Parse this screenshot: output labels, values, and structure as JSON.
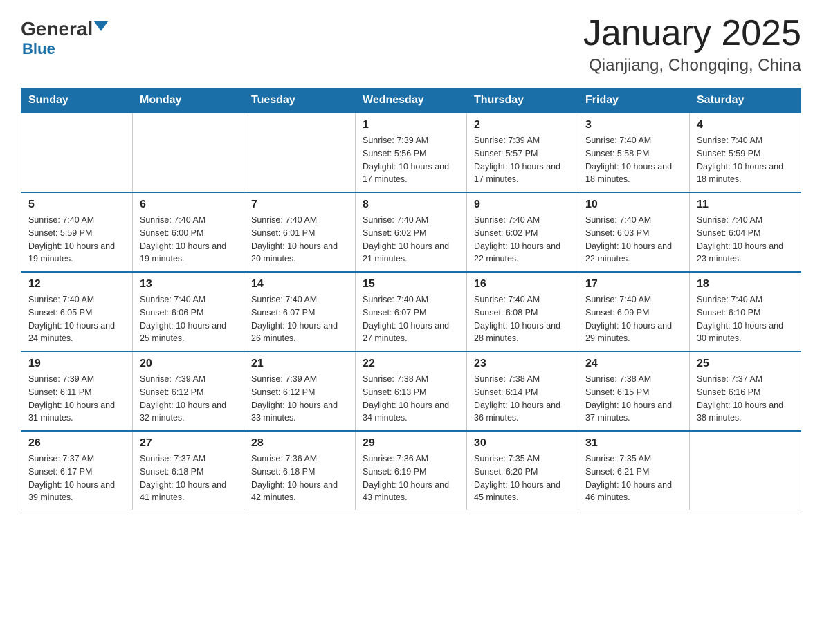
{
  "header": {
    "logo_general": "General",
    "logo_blue": "Blue",
    "title": "January 2025",
    "subtitle": "Qianjiang, Chongqing, China"
  },
  "days_of_week": [
    "Sunday",
    "Monday",
    "Tuesday",
    "Wednesday",
    "Thursday",
    "Friday",
    "Saturday"
  ],
  "weeks": [
    [
      {
        "day": "",
        "info": ""
      },
      {
        "day": "",
        "info": ""
      },
      {
        "day": "",
        "info": ""
      },
      {
        "day": "1",
        "info": "Sunrise: 7:39 AM\nSunset: 5:56 PM\nDaylight: 10 hours\nand 17 minutes."
      },
      {
        "day": "2",
        "info": "Sunrise: 7:39 AM\nSunset: 5:57 PM\nDaylight: 10 hours\nand 17 minutes."
      },
      {
        "day": "3",
        "info": "Sunrise: 7:40 AM\nSunset: 5:58 PM\nDaylight: 10 hours\nand 18 minutes."
      },
      {
        "day": "4",
        "info": "Sunrise: 7:40 AM\nSunset: 5:59 PM\nDaylight: 10 hours\nand 18 minutes."
      }
    ],
    [
      {
        "day": "5",
        "info": "Sunrise: 7:40 AM\nSunset: 5:59 PM\nDaylight: 10 hours\nand 19 minutes."
      },
      {
        "day": "6",
        "info": "Sunrise: 7:40 AM\nSunset: 6:00 PM\nDaylight: 10 hours\nand 19 minutes."
      },
      {
        "day": "7",
        "info": "Sunrise: 7:40 AM\nSunset: 6:01 PM\nDaylight: 10 hours\nand 20 minutes."
      },
      {
        "day": "8",
        "info": "Sunrise: 7:40 AM\nSunset: 6:02 PM\nDaylight: 10 hours\nand 21 minutes."
      },
      {
        "day": "9",
        "info": "Sunrise: 7:40 AM\nSunset: 6:02 PM\nDaylight: 10 hours\nand 22 minutes."
      },
      {
        "day": "10",
        "info": "Sunrise: 7:40 AM\nSunset: 6:03 PM\nDaylight: 10 hours\nand 22 minutes."
      },
      {
        "day": "11",
        "info": "Sunrise: 7:40 AM\nSunset: 6:04 PM\nDaylight: 10 hours\nand 23 minutes."
      }
    ],
    [
      {
        "day": "12",
        "info": "Sunrise: 7:40 AM\nSunset: 6:05 PM\nDaylight: 10 hours\nand 24 minutes."
      },
      {
        "day": "13",
        "info": "Sunrise: 7:40 AM\nSunset: 6:06 PM\nDaylight: 10 hours\nand 25 minutes."
      },
      {
        "day": "14",
        "info": "Sunrise: 7:40 AM\nSunset: 6:07 PM\nDaylight: 10 hours\nand 26 minutes."
      },
      {
        "day": "15",
        "info": "Sunrise: 7:40 AM\nSunset: 6:07 PM\nDaylight: 10 hours\nand 27 minutes."
      },
      {
        "day": "16",
        "info": "Sunrise: 7:40 AM\nSunset: 6:08 PM\nDaylight: 10 hours\nand 28 minutes."
      },
      {
        "day": "17",
        "info": "Sunrise: 7:40 AM\nSunset: 6:09 PM\nDaylight: 10 hours\nand 29 minutes."
      },
      {
        "day": "18",
        "info": "Sunrise: 7:40 AM\nSunset: 6:10 PM\nDaylight: 10 hours\nand 30 minutes."
      }
    ],
    [
      {
        "day": "19",
        "info": "Sunrise: 7:39 AM\nSunset: 6:11 PM\nDaylight: 10 hours\nand 31 minutes."
      },
      {
        "day": "20",
        "info": "Sunrise: 7:39 AM\nSunset: 6:12 PM\nDaylight: 10 hours\nand 32 minutes."
      },
      {
        "day": "21",
        "info": "Sunrise: 7:39 AM\nSunset: 6:12 PM\nDaylight: 10 hours\nand 33 minutes."
      },
      {
        "day": "22",
        "info": "Sunrise: 7:38 AM\nSunset: 6:13 PM\nDaylight: 10 hours\nand 34 minutes."
      },
      {
        "day": "23",
        "info": "Sunrise: 7:38 AM\nSunset: 6:14 PM\nDaylight: 10 hours\nand 36 minutes."
      },
      {
        "day": "24",
        "info": "Sunrise: 7:38 AM\nSunset: 6:15 PM\nDaylight: 10 hours\nand 37 minutes."
      },
      {
        "day": "25",
        "info": "Sunrise: 7:37 AM\nSunset: 6:16 PM\nDaylight: 10 hours\nand 38 minutes."
      }
    ],
    [
      {
        "day": "26",
        "info": "Sunrise: 7:37 AM\nSunset: 6:17 PM\nDaylight: 10 hours\nand 39 minutes."
      },
      {
        "day": "27",
        "info": "Sunrise: 7:37 AM\nSunset: 6:18 PM\nDaylight: 10 hours\nand 41 minutes."
      },
      {
        "day": "28",
        "info": "Sunrise: 7:36 AM\nSunset: 6:18 PM\nDaylight: 10 hours\nand 42 minutes."
      },
      {
        "day": "29",
        "info": "Sunrise: 7:36 AM\nSunset: 6:19 PM\nDaylight: 10 hours\nand 43 minutes."
      },
      {
        "day": "30",
        "info": "Sunrise: 7:35 AM\nSunset: 6:20 PM\nDaylight: 10 hours\nand 45 minutes."
      },
      {
        "day": "31",
        "info": "Sunrise: 7:35 AM\nSunset: 6:21 PM\nDaylight: 10 hours\nand 46 minutes."
      },
      {
        "day": "",
        "info": ""
      }
    ]
  ]
}
